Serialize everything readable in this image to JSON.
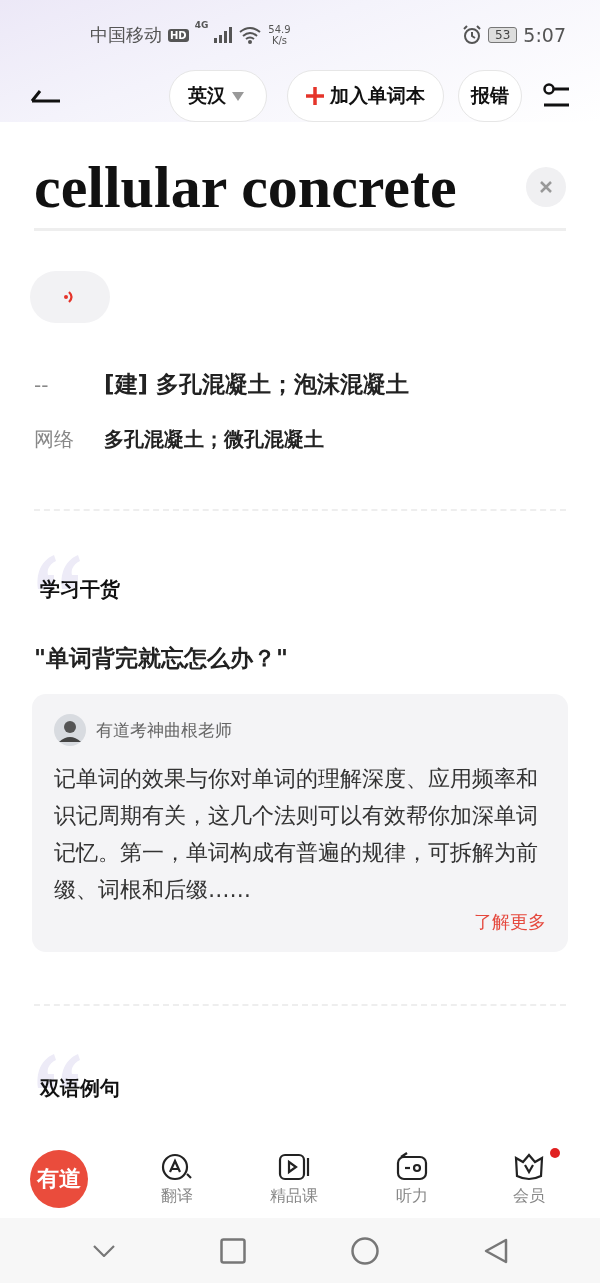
{
  "status_bar": {
    "carrier": "中国移动",
    "hd": "HD",
    "network": "4G",
    "speed_value": "54.9",
    "speed_unit": "K/s",
    "battery": "53",
    "time": "5:07"
  },
  "toolbar": {
    "language": "英汉",
    "add_button": "加入单词本",
    "report_button": "报错"
  },
  "word": {
    "text": "cellular concrete"
  },
  "definitions": [
    {
      "label": "--",
      "text": "[建] 多孔混凝土；泡沫混凝土"
    },
    {
      "label": "网络",
      "text": "多孔混凝土；微孔混凝土"
    }
  ],
  "tips": {
    "section_title": "学习干货",
    "question": "\"单词背完就忘怎么办？\"",
    "author": "有道考神曲根老师",
    "body": "记单词的效果与你对单词的理解深度、应用频率和识记周期有关，这几个法则可以有效帮你加深单词记忆。第一，单词构成有普遍的规律，可拆解为前缀、词根和后缀……",
    "more_link": "了解更多"
  },
  "examples": {
    "section_title": "双语例句"
  },
  "tab_bar": [
    {
      "kind": "logo",
      "label": "有道"
    },
    {
      "kind": "translate",
      "label": "翻译",
      "badge": false
    },
    {
      "kind": "course",
      "label": "精品课",
      "badge": false
    },
    {
      "kind": "listen",
      "label": "听力",
      "badge": false
    },
    {
      "kind": "vip",
      "label": "会员",
      "badge": true
    }
  ]
}
